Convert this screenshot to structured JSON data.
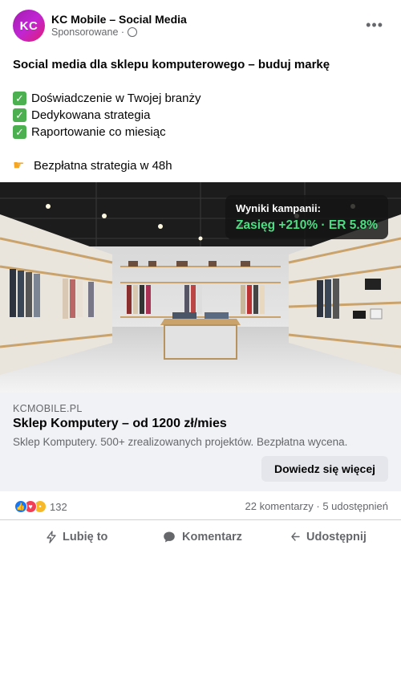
{
  "post": {
    "avatar_initials": "KC",
    "page_name": "KC Mobile – Social Media",
    "sponsored": "Sponsorowane ·",
    "more": "•••",
    "headline": "Social media dla sklepu komputerowego – buduj markę",
    "bullets": [
      "Doświadczenie w Twojej branży",
      "Dedykowana strategia",
      "Raportowanie co miesiąc"
    ],
    "offer": "Bezpłatna strategia w 48h"
  },
  "media": {
    "overlay_title": "Wyniki kampanii:",
    "overlay_metric": "Zasięg +210% · ER 5.8%"
  },
  "link": {
    "domain": "KCMOBILE.PL",
    "title": "Sklep Komputery – od 1200 zł/mies",
    "description": "Sklep Komputery. 500+ zrealizowanych projektów. Bezpłatna wycena.",
    "cta": "Dowiedz się więcej"
  },
  "stats": {
    "reactions": "132",
    "comments_shares": "22 komentarzy · 5 udostępnień"
  },
  "actions": {
    "like": "Lubię to",
    "comment": "Komentarz",
    "share": "Udostępnij"
  },
  "colors": {
    "accent_green": "#4ade80",
    "link_bg": "#f0f2f5",
    "like_blue": "#1877f2"
  }
}
